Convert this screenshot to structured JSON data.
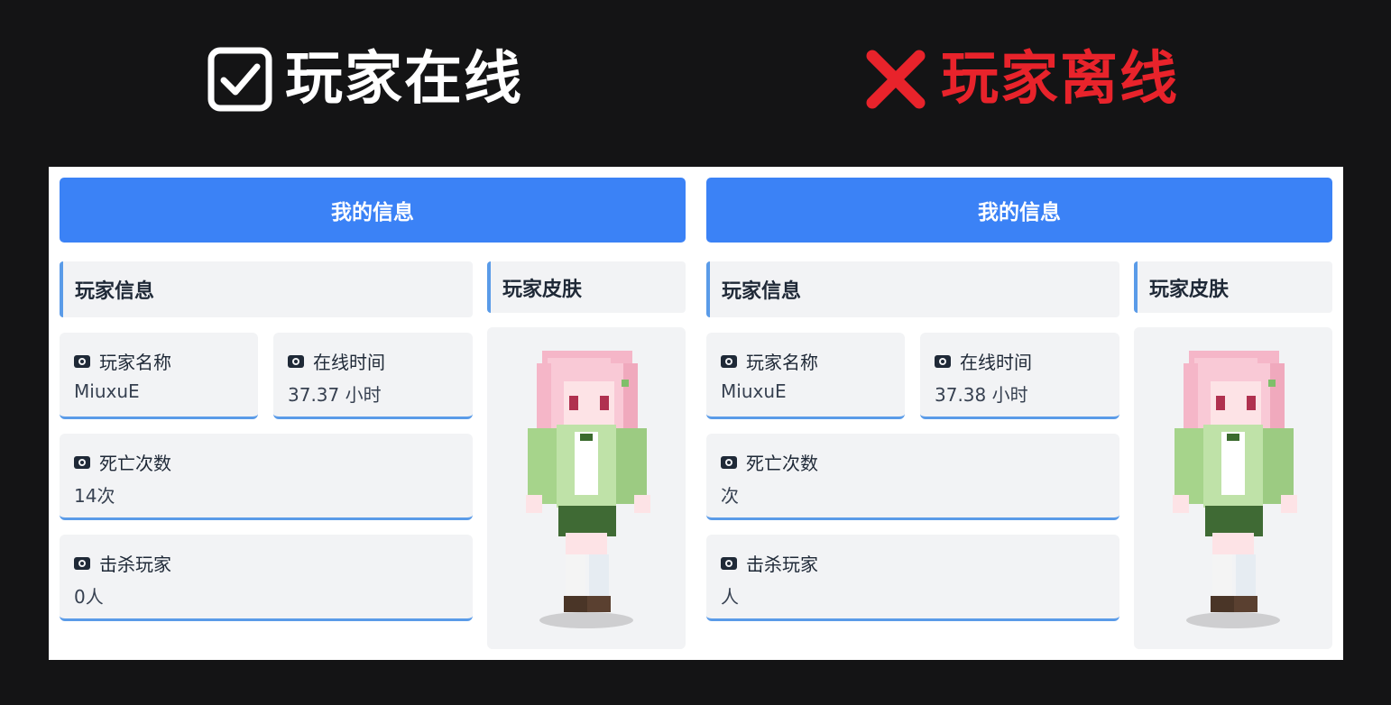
{
  "headers": {
    "online": "玩家在线",
    "offline": "玩家离线"
  },
  "colors": {
    "background": "#141415",
    "banner": "#3b82f6",
    "accent_border": "#5a9be8",
    "card_bg": "#f2f3f5",
    "offline_red": "#e8232b"
  },
  "icons": {
    "online": "checkbox-checked-icon",
    "offline": "red-x-icon",
    "field": "eye-icon"
  },
  "online_panel": {
    "banner": "我的信息",
    "info_title": "玩家信息",
    "skin_title": "玩家皮肤",
    "name_label": "玩家名称",
    "name_value": "MiuxuE",
    "time_label": "在线时间",
    "time_value": "37.37 小时",
    "death_label": "死亡次数",
    "death_value": "14次",
    "kill_label": "击杀玩家",
    "kill_value": "0人"
  },
  "offline_panel": {
    "banner": "我的信息",
    "info_title": "玩家信息",
    "skin_title": "玩家皮肤",
    "name_label": "玩家名称",
    "name_value": "MiuxuE",
    "time_label": "在线时间",
    "time_value": "37.38 小时",
    "death_label": "死亡次数",
    "death_value": "次",
    "kill_label": "击杀玩家",
    "kill_value": "人"
  }
}
